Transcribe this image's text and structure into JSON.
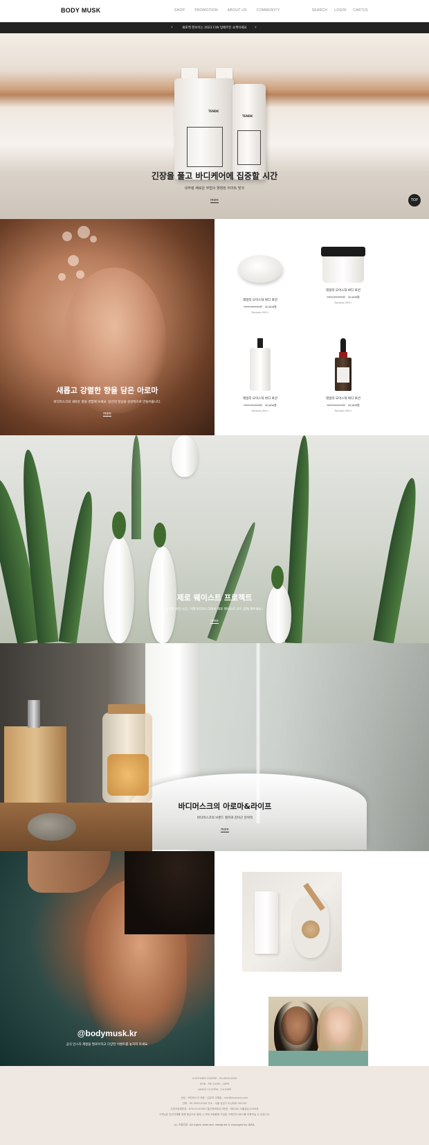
{
  "header": {
    "logo": "BODY MUSK",
    "nav": [
      "SHOP",
      "PROMOTION",
      "ABOUT US",
      "COMMUNITY"
    ],
    "util": [
      "SEARCH",
      "LOGIN",
      "CART(0)"
    ]
  },
  "notice": {
    "text": "쇄로케 펀보이는 2023 F/W 텅베르틴 쇼케이세요",
    "prev": "‹",
    "next": "›"
  },
  "hero": {
    "title": "긴장을 풀고 바디케어에 집중할 시간",
    "subtitle": "내주렁 쌔로운 무엽의 향장된 아이트 맞크",
    "more": "more",
    "top_button": "TOP",
    "bottle_brand": "TENDK"
  },
  "aroma": {
    "title": "새롭고 강렬한 향을 담은 아로마",
    "subtitle": "바디머스크의 새로운 향을 경험해 보세요. 당신의 일상을 감성적으로 만들어줍니다.",
    "more": "more",
    "products": [
      {
        "name": "데일리 모이스처 바디 로션",
        "orig": "50% 40,000원",
        "sale": "20,000원",
        "reviews": "Reviews 999+"
      },
      {
        "name": "데일리 모이스처 바디 로션",
        "orig": "50% 40,000원",
        "sale": "20,000원",
        "reviews": "Reviews 999+"
      },
      {
        "name": "데일리 모이스처 바디 로션",
        "orig": "50% 40,000원",
        "sale": "20,000원",
        "reviews": "Reviews 999+"
      },
      {
        "name": "데일리 모이스처 바디 로션",
        "orig": "50% 40,000원",
        "sale": "20,000원",
        "reviews": "Reviews 999+"
      }
    ]
  },
  "zero": {
    "title": "제로 웨이스트 프로젝트",
    "subtitle": "지구를 위한 시간, 이제 바디머스크에서 제로 웨이스트 모두 함께 해주세요 !",
    "more": "more"
  },
  "life": {
    "title": "바디머스크의 아로마&라이프",
    "subtitle": "바디머스크의 브랜드 철학과 감이곤 분위적",
    "more": "more"
  },
  "insta": {
    "handle": "@bodymusk.kr",
    "subtitle": "공식 인스타 계정을 팔로우하고 다양한 이벤트를 놓치지 마세요."
  },
  "footer": {
    "lines": [
      "CUSTOMER CENTER : 00-0000-0000",
      "MON - FRI 10AM - 18PM",
      "LUNCH 12:30PM - 13:30PM",
      "상호 : 바디머스크  대표 : 김유리  이메일 : info@example.com",
      "전화 : 00-0000-0000  주소 : 서울 강남구 도산대로 000-00",
      "사업자등록번호 : 000-00-00000  통신판매업신고번호 : 제0000-서울강남-0000호",
      "고객님은 안전거래를 위해 현금으로 결제 시 저희 쇼핑몰에 가입한 구매안전서비스를 이용하실 수 있습니다."
    ],
    "copyright": "(c) 스튜디오. All rights reserved. designed & managed by WEA."
  }
}
